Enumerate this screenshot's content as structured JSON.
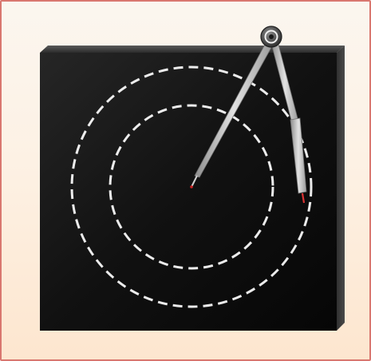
{
  "scene": {
    "frame_color": "#d9776f",
    "board_color": "#0d0d0d",
    "dash_color": "#ffffff",
    "compass_color": "#b8b8b8",
    "tip_color": "#cc2222",
    "icons": [
      "compass-icon",
      "black-board",
      "dashed-circle-outer",
      "dashed-circle-inner"
    ]
  }
}
